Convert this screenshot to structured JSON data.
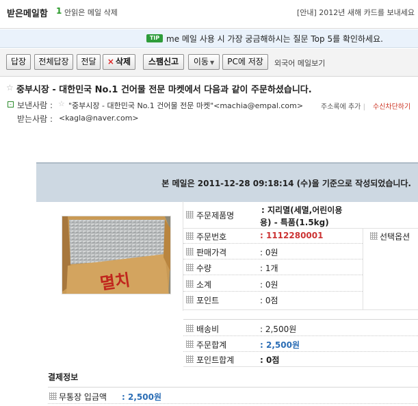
{
  "header": {
    "mailbox_title": "받은메일함",
    "unread_count": "1",
    "unread_delete": "안읽은 메일 삭제",
    "notice": "[안내] 2012년 새해 카드를 보내세요"
  },
  "tip": {
    "badge": "TIP",
    "text": "me 메일 사용 시 가장 궁금해하시는 질문 Top 5를 확인하세요."
  },
  "toolbar": {
    "reply": "답장",
    "reply_all": "전체답장",
    "forward": "전달",
    "delete_mark": "×",
    "delete": "삭제",
    "spam": "스팸신고",
    "move": "이동",
    "move_caret": "▼",
    "save_pc": "PC에 저장",
    "foreign_view": "외국어 메일보기"
  },
  "message": {
    "subject_star": "☆",
    "subject": "중부시장 - 대한민국 No.1 건어물 전문 마켓에서 다음과 같이 주문하셨습니다.",
    "from_toggle": "-",
    "from_label": "보낸사람 :",
    "from_star": "☆",
    "from_value": "\"중부시장 - 대한민국 No.1 건어물 전문 마켓\"<machia@empal.com>",
    "add_contact": "주소록에 추가",
    "separator": "|",
    "block_sender": "수신차단하기",
    "to_label": "받는사람 :",
    "to_value": "<kagla@naver.com>"
  },
  "order": {
    "header_text": "본 메일은 2011-12-28 09:18:14 (수)을 기준으로 작성되었습니다.",
    "option_label": "선택옵션",
    "rows": [
      {
        "label": "주문제품명",
        "value": "지리멸(세멸,어린이용",
        "value2": "용) - 특품(1.5kg)"
      },
      {
        "label": "주문번호",
        "value": "1112280001"
      },
      {
        "label": "판매가격",
        "value": "0원"
      },
      {
        "label": "수량",
        "value": "1개"
      },
      {
        "label": "소계",
        "value": "0원"
      },
      {
        "label": "포인트",
        "value": "0점"
      },
      {
        "label": "배송비",
        "value": "2,500원"
      },
      {
        "label": "주문합계",
        "value": "2,500원"
      },
      {
        "label": "포인트합계",
        "value": "0점"
      }
    ],
    "product_image_text": "멸치"
  },
  "payment": {
    "title": "결제정보",
    "rows": [
      {
        "label": "무통장 입금액",
        "value": "2,500원"
      }
    ]
  }
}
